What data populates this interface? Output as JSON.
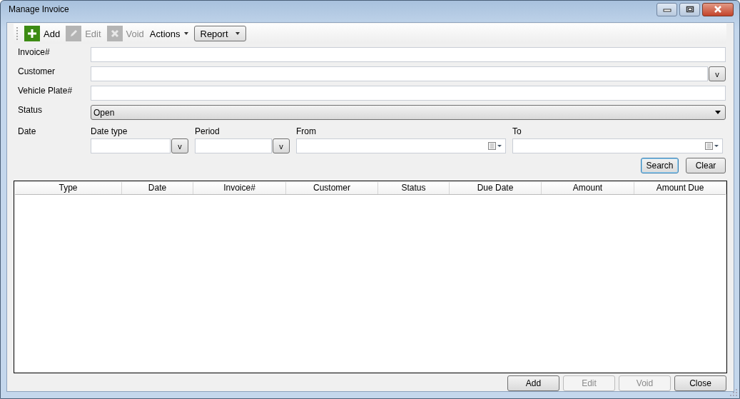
{
  "window": {
    "title": "Manage Invoice"
  },
  "toolbar": [
    {
      "kind": "icon-button",
      "label": "Add",
      "disabled": false
    },
    {
      "kind": "icon-button",
      "label": "Edit",
      "disabled": true
    },
    {
      "kind": "icon-button",
      "label": "Void",
      "disabled": true
    },
    {
      "kind": "menu",
      "label": "Actions",
      "disabled": false
    },
    {
      "kind": "dropdown-button",
      "label": "Report",
      "disabled": false
    }
  ],
  "filters": {
    "invoice": {
      "label": "Invoice#"
    },
    "customer": {
      "label": "Customer",
      "button": "v"
    },
    "vehicle_plate": {
      "label": "Vehicle Plate#"
    },
    "status": {
      "label": "Status",
      "value": "Open"
    },
    "date": {
      "label": "Date",
      "fields": [
        {
          "kind": "combo",
          "label": "Date type",
          "button": "v"
        },
        {
          "kind": "combo",
          "label": "Period",
          "button": "v"
        },
        {
          "kind": "date",
          "label": "From"
        },
        {
          "kind": "date",
          "label": "To"
        }
      ]
    },
    "buttons": [
      {
        "label": "Search",
        "default": true
      },
      {
        "label": "Clear",
        "default": false
      }
    ]
  },
  "table": {
    "columns": [
      "Type",
      "Date",
      "Invoice#",
      "Customer",
      "Status",
      "Due Date",
      "Amount",
      "Amount Due"
    ]
  },
  "buttons": [
    {
      "label": "Add",
      "disabled": false
    },
    {
      "label": "Edit",
      "disabled": true
    },
    {
      "label": "Void",
      "disabled": true
    },
    {
      "label": "Close",
      "disabled": false
    }
  ]
}
